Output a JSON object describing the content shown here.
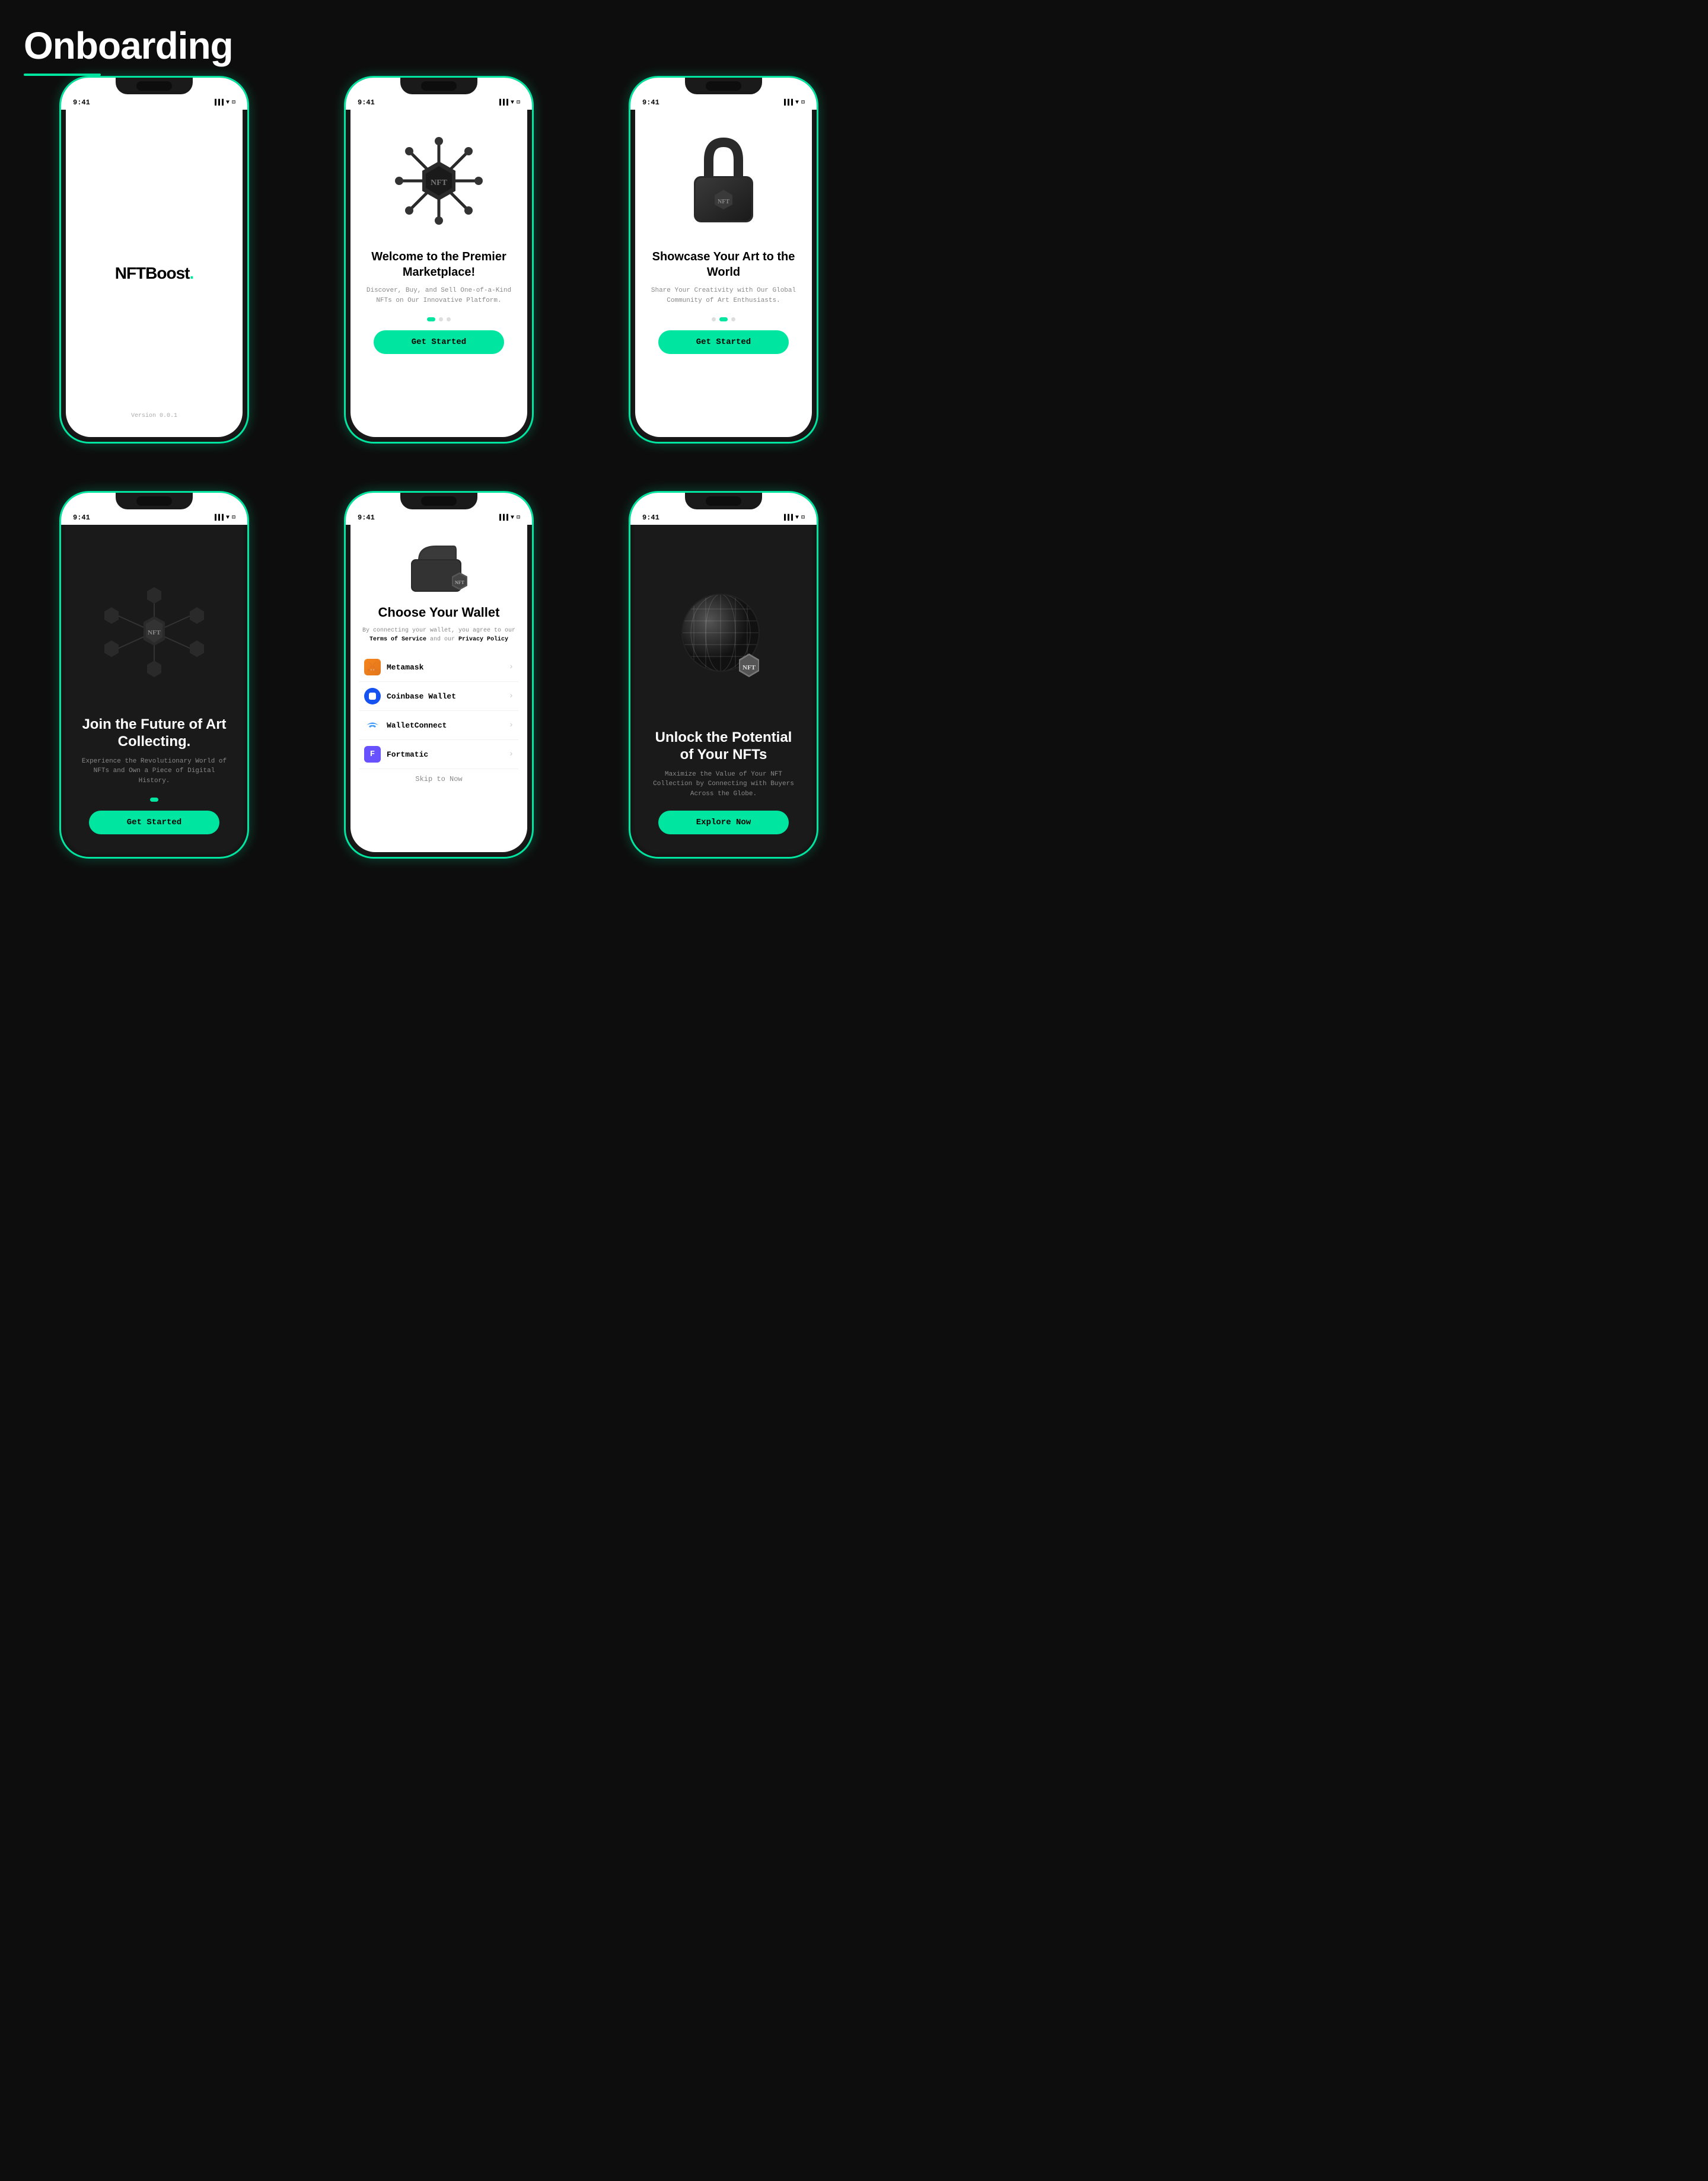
{
  "header": {
    "title": "Onboarding"
  },
  "phones": [
    {
      "id": "phone-1",
      "type": "splash",
      "status_time": "9:41",
      "logo_text": "NFTBoost",
      "logo_dot": ".",
      "version": "Version 0.0.1"
    },
    {
      "id": "phone-2",
      "type": "onboard",
      "status_time": "9:41",
      "icon_type": "nft-virus",
      "title": "Welcome to the Premier Marketplace!",
      "subtitle": "Discover, Buy, and Sell One-of-a-Kind NFTs on Our Innovative Platform.",
      "dots": [
        true,
        false,
        false
      ],
      "button_label": "Get Started"
    },
    {
      "id": "phone-3",
      "type": "onboard",
      "status_time": "9:41",
      "icon_type": "nft-lock",
      "title": "Showcase Your Art to the World",
      "subtitle": "Share Your Creativity with Our Global Community of Art Enthusiasts.",
      "dots": [
        false,
        true,
        false
      ],
      "button_label": "Get Started"
    },
    {
      "id": "phone-4",
      "type": "dark-onboard",
      "status_time": "9:41",
      "icon_type": "nft-network",
      "title": "Join the Future of Art Collecting.",
      "subtitle": "Experience the Revolutionary World of NFTs and Own a Piece of Digital History.",
      "dot_active": true,
      "button_label": "Get Started"
    },
    {
      "id": "phone-5",
      "type": "wallet-connect",
      "status_time": "9:41",
      "icon_type": "nft-wallet",
      "title": "Choose Your Wallet",
      "subtitle_part1": "By connecting your wallet, you agree to our ",
      "subtitle_tos": "Terms of Service",
      "subtitle_part2": " and our ",
      "subtitle_pp": "Privacy Policy",
      "wallets": [
        {
          "name": "Metamask",
          "icon": "metamask"
        },
        {
          "name": "Coinbase Wallet",
          "icon": "coinbase"
        },
        {
          "name": "WalletConnect",
          "icon": "walletconnect"
        },
        {
          "name": "Fortmatic",
          "icon": "fortmatic"
        }
      ],
      "skip_label": "Skip to Now"
    },
    {
      "id": "phone-6",
      "type": "dark-onboard-2",
      "status_time": "9:41",
      "icon_type": "nft-globe",
      "title": "Unlock the Potential of Your NFTs",
      "subtitle": "Maximize the Value of Your NFT Collection by Connecting with Buyers Across the Globe.",
      "button_label": "Explore Now"
    }
  ]
}
